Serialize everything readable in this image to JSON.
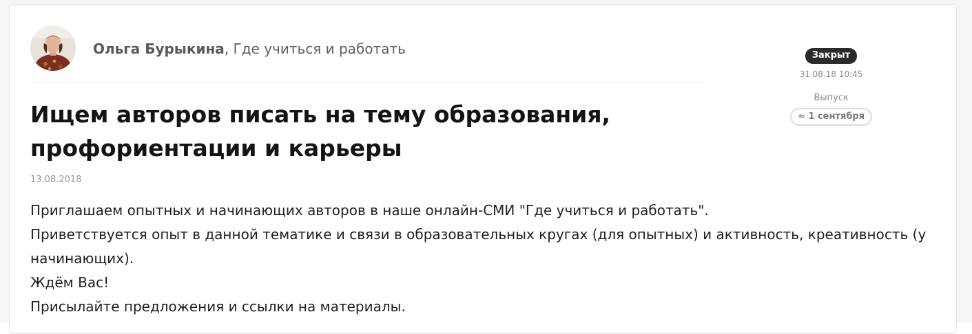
{
  "post": {
    "author": {
      "name": "Ольга Бурыкина",
      "separator": ",",
      "organization": " Где учиться и работать"
    },
    "title": "Ищем авторов писать на тему образования, профориентации и карьеры",
    "date": "13.08.2018",
    "body": [
      "Приглашаем опытных и начинающих авторов в наше онлайн-СМИ \"Где учиться и работать\".",
      "Приветствуется опыт в данной тематике и связи в образовательных кругах (для опытных) и активность, креативность (у начинающих).",
      "Ждём Вас!",
      "Присылайте предложения и ссылки на материалы."
    ]
  },
  "status": {
    "badge": "Закрыт",
    "closed_at": "31.08.18 10:45",
    "issue_label": "Выпуск",
    "issue_value": "≈ 1 сентября"
  },
  "colors": {
    "badge_bg": "#2b2b2b",
    "chip_border": "#dcdcdc",
    "text": "#1f1f1f"
  }
}
